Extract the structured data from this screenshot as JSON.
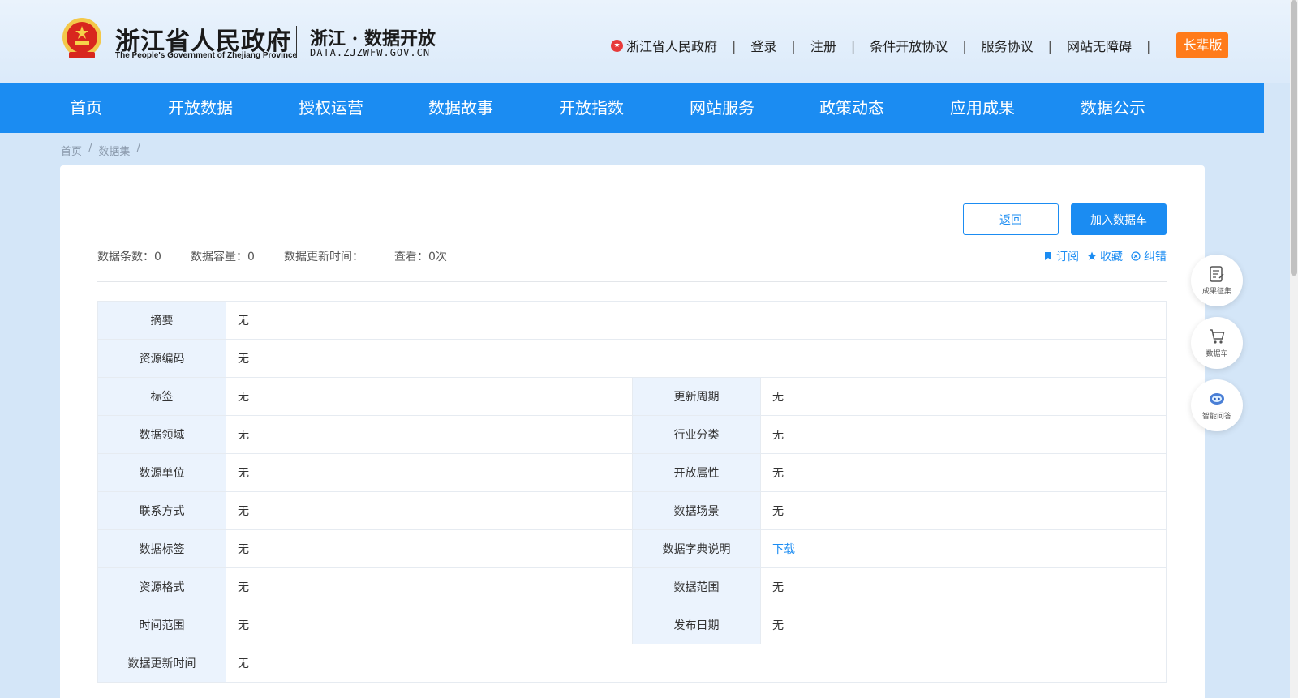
{
  "header": {
    "gov_title": "浙江省人民政府",
    "gov_subtitle": "The People's Government of Zhejiang Province",
    "site_title": "浙江 · 数据开放",
    "site_domain": "DATA.ZJZWFW.GOV.CN",
    "links": [
      "浙江省人民政府",
      "登录",
      "注册",
      "条件开放协议",
      "服务协议",
      "网站无障碍"
    ],
    "separator": "|",
    "elder_label": "长辈版"
  },
  "nav": {
    "items": [
      "首页",
      "开放数据",
      "授权运营",
      "数据故事",
      "开放指数",
      "网站服务",
      "政策动态",
      "应用成果",
      "数据公示"
    ]
  },
  "breadcrumb": {
    "items": [
      "首页",
      "数据集"
    ],
    "separator": "/"
  },
  "toolbar": {
    "back_label": "返回",
    "cart_label": "加入数据车"
  },
  "stats": {
    "count": "数据条数：0",
    "size": "数据容量：0",
    "update": "数据更新时间：",
    "views": "查看：0次"
  },
  "actions": {
    "subscribe": "订阅",
    "favorite": "收藏",
    "report": "纠错"
  },
  "meta_table": {
    "summary_k": "摘要",
    "summary_v": "无",
    "code_k": "资源编码",
    "code_v": "无",
    "tag_k": "标签",
    "tag_v": "无",
    "cycle_k": "更新周期",
    "cycle_v": "无",
    "domain_k": "数据领域",
    "domain_v": "无",
    "industry_k": "行业分类",
    "industry_v": "无",
    "unit_k": "数源单位",
    "unit_v": "无",
    "open_k": "开放属性",
    "open_v": "无",
    "contact_k": "联系方式",
    "contact_v": "无",
    "scene_k": "数据场景",
    "scene_v": "无",
    "dtag_k": "数据标签",
    "dtag_v": "无",
    "dict_k": "数据字典说明",
    "dict_v": "下载",
    "format_k": "资源格式",
    "format_v": "无",
    "range_k": "数据范围",
    "range_v": "无",
    "time_k": "时间范围",
    "time_v": "无",
    "pub_k": "发布日期",
    "pub_v": "无",
    "updated_k": "数据更新时间",
    "updated_v": "无"
  },
  "floating": {
    "collect": "成果征集",
    "cart": "数据车",
    "qa": "智能问答"
  },
  "colors": {
    "primary": "#1b8cf2",
    "elder": "#ff7b1a",
    "key_cell": "#ebf3fd"
  }
}
